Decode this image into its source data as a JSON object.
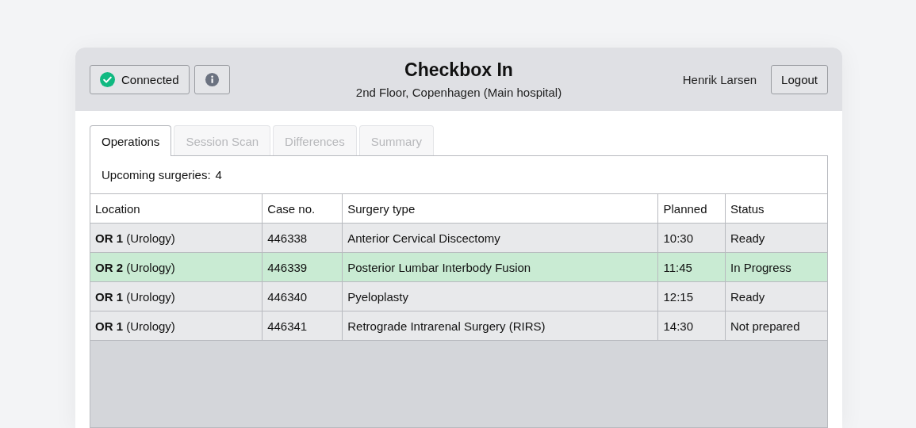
{
  "header": {
    "connection": {
      "label": "Connected",
      "connected": true
    },
    "title": "Checkbox In",
    "subtitle": "2nd Floor, Copenhagen (Main hospital)",
    "user": "Henrik Larsen",
    "logout": "Logout"
  },
  "tabs": [
    {
      "label": "Operations",
      "selected": true
    },
    {
      "label": "Session Scan",
      "selected": false
    },
    {
      "label": "Differences",
      "selected": false
    },
    {
      "label": "Summary",
      "selected": false
    }
  ],
  "summary": {
    "label": "Upcoming surgeries:",
    "count": "4"
  },
  "table": {
    "columns": [
      "Location",
      "Case no.",
      "Surgery type",
      "Planned",
      "Status"
    ],
    "rows": [
      {
        "selected": false,
        "cells": [
          "**OR 1** (Urology)",
          "446338",
          "Anterior Cervical Discectomy",
          "10:30",
          "Ready"
        ]
      },
      {
        "selected": true,
        "cells": [
          "**OR 2** (Urology)",
          "446339",
          "Posterior Lumbar Interbody Fusion",
          "11:45",
          "In Progress"
        ]
      },
      {
        "selected": false,
        "cells": [
          "**OR 1** (Urology)",
          "446340",
          "Pyeloplasty",
          "12:15",
          "Ready"
        ]
      },
      {
        "selected": false,
        "cells": [
          "**OR 1** (Urology)",
          "446341",
          "Retrograde Intrarenal Surgery (RIRS)",
          "14:30",
          "Not prepared"
        ]
      }
    ]
  }
}
